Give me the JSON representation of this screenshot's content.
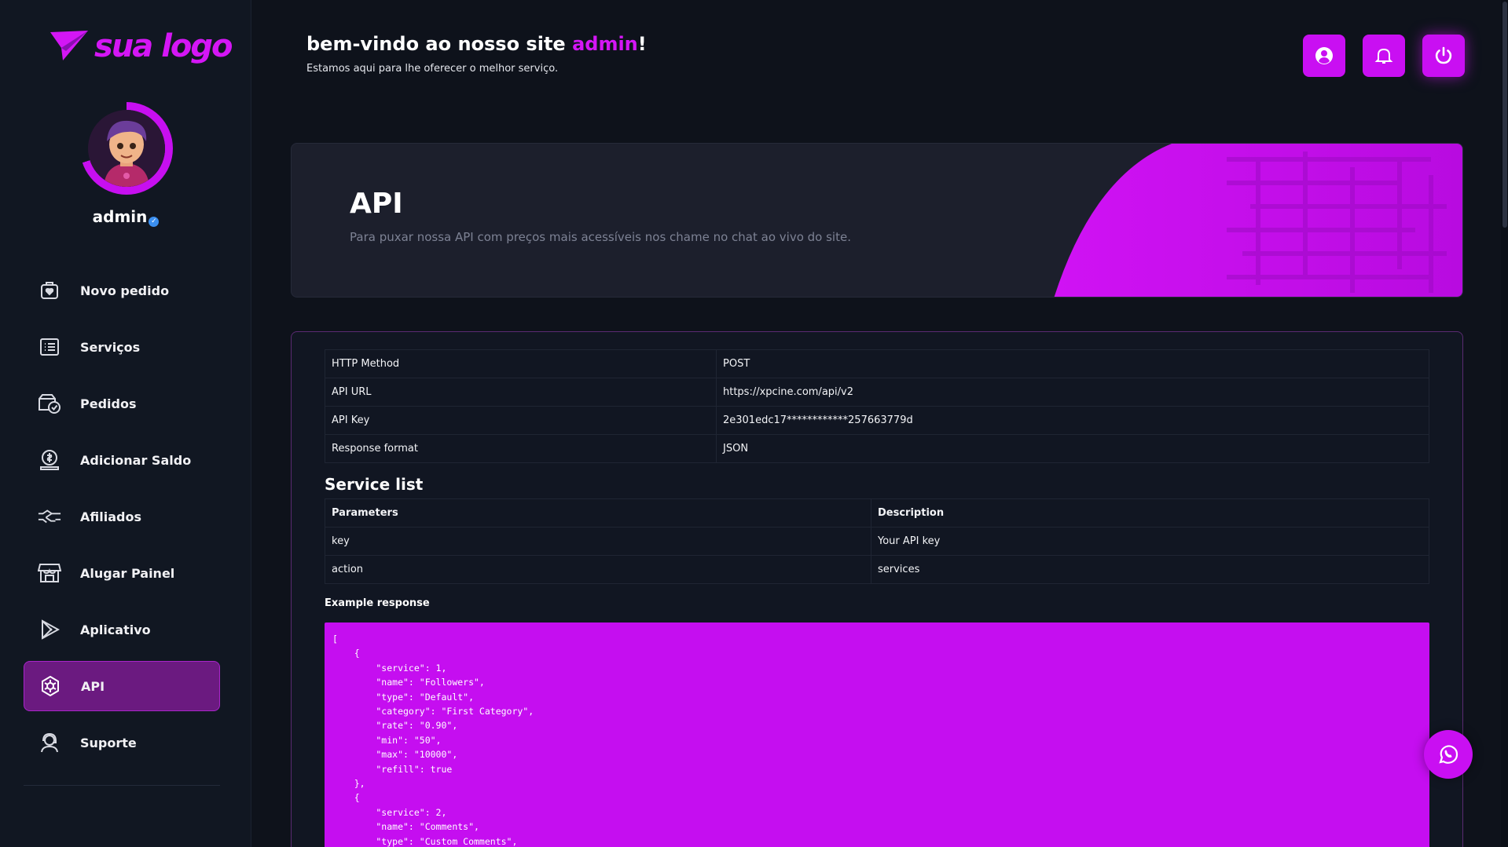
{
  "brand": {
    "logo_text": "sua logo",
    "accent": "#c90ff2"
  },
  "user": {
    "name": "admin"
  },
  "sidebar": {
    "items": [
      {
        "label": "Novo pedido",
        "icon": "cart-icon"
      },
      {
        "label": "Serviços",
        "icon": "list-icon"
      },
      {
        "label": "Pedidos",
        "icon": "orders-check-icon"
      },
      {
        "label": "Adicionar Saldo",
        "icon": "money-icon"
      },
      {
        "label": "Afiliados",
        "icon": "handshake-icon"
      },
      {
        "label": "Alugar Painel",
        "icon": "store-icon"
      },
      {
        "label": "Aplicativo",
        "icon": "play-icon"
      },
      {
        "label": "API",
        "icon": "api-gear-icon",
        "active": true
      },
      {
        "label": "Suporte",
        "icon": "support-icon"
      }
    ]
  },
  "header": {
    "welcome_prefix": "bem-vindo ao nosso site ",
    "welcome_name": "admin",
    "welcome_suffix": "!",
    "subtitle": "Estamos aqui para lhe oferecer o melhor serviço."
  },
  "banner": {
    "title": "API",
    "description": "Para puxar nossa API com preços mais acessíveis nos chame no chat ao vivo do site."
  },
  "api_info": [
    {
      "key": "HTTP Method",
      "value": "POST"
    },
    {
      "key": "API URL",
      "value": "https://xpcine.com/api/v2"
    },
    {
      "key": "API Key",
      "value": "2e301edc17************257663779d"
    },
    {
      "key": "Response format",
      "value": "JSON"
    }
  ],
  "service_list": {
    "title": "Service list",
    "headers": {
      "param": "Parameters",
      "desc": "Description"
    },
    "rows": [
      {
        "param": "key",
        "desc": "Your API key"
      },
      {
        "param": "action",
        "desc": "services"
      }
    ]
  },
  "example": {
    "title": "Example response",
    "code": "[\n    {\n        \"service\": 1,\n        \"name\": \"Followers\",\n        \"type\": \"Default\",\n        \"category\": \"First Category\",\n        \"rate\": \"0.90\",\n        \"min\": \"50\",\n        \"max\": \"10000\",\n        \"refill\": true\n    },\n    {\n        \"service\": 2,\n        \"name\": \"Comments\",\n        \"type\": \"Custom Comments\","
  }
}
